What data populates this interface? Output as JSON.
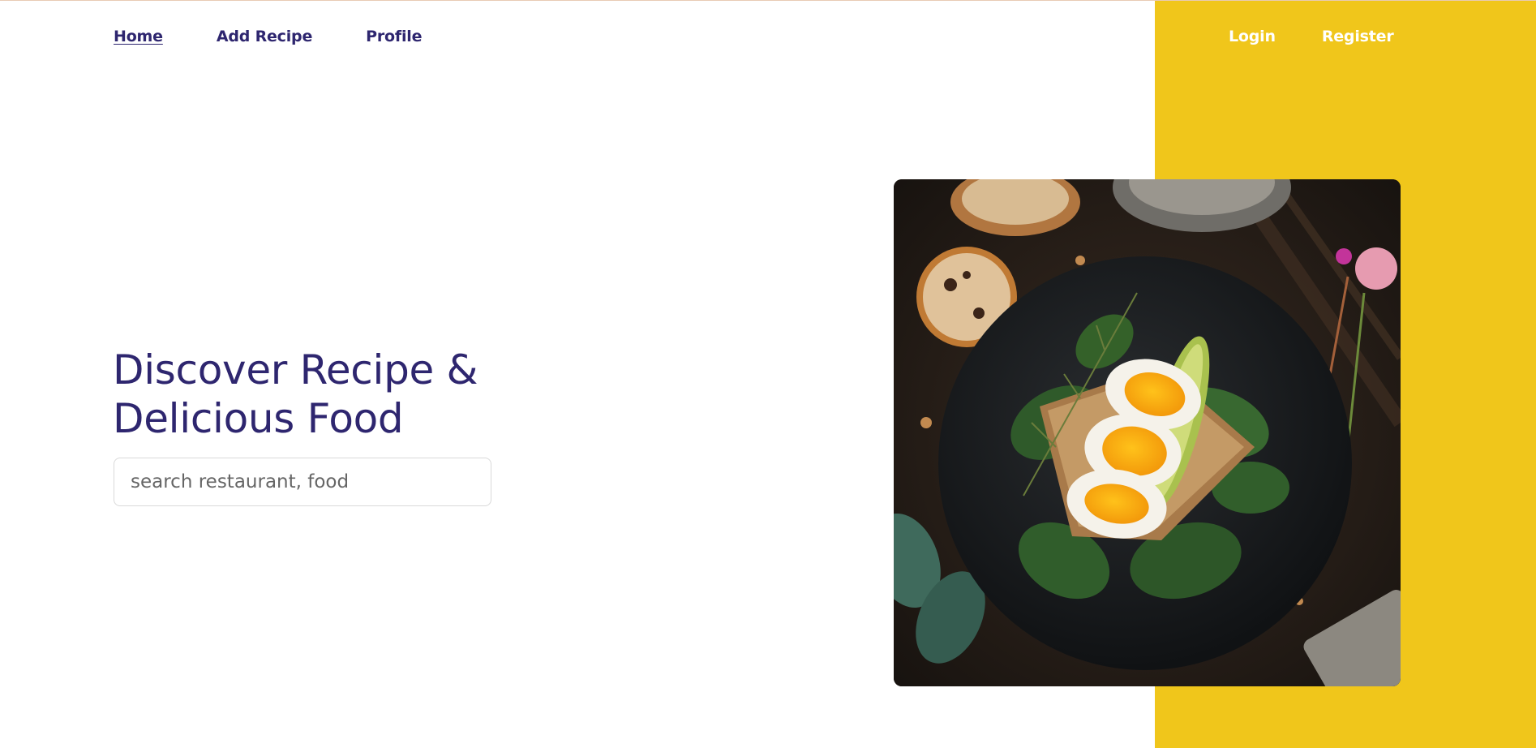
{
  "nav": {
    "items": [
      {
        "label": "Home",
        "active": true
      },
      {
        "label": "Add Recipe",
        "active": false
      },
      {
        "label": "Profile",
        "active": false
      }
    ]
  },
  "auth": {
    "login_label": "Login",
    "register_label": "Register"
  },
  "hero": {
    "title_line1": "Discover Recipe &",
    "title_line2": "Delicious Food"
  },
  "search": {
    "placeholder": "search restaurant, food",
    "value": ""
  },
  "hero_image": {
    "icon": "food-photo-egg-avocado-toast"
  },
  "colors": {
    "brand_text": "#2e266f",
    "accent_yellow": "#f0c61b"
  }
}
